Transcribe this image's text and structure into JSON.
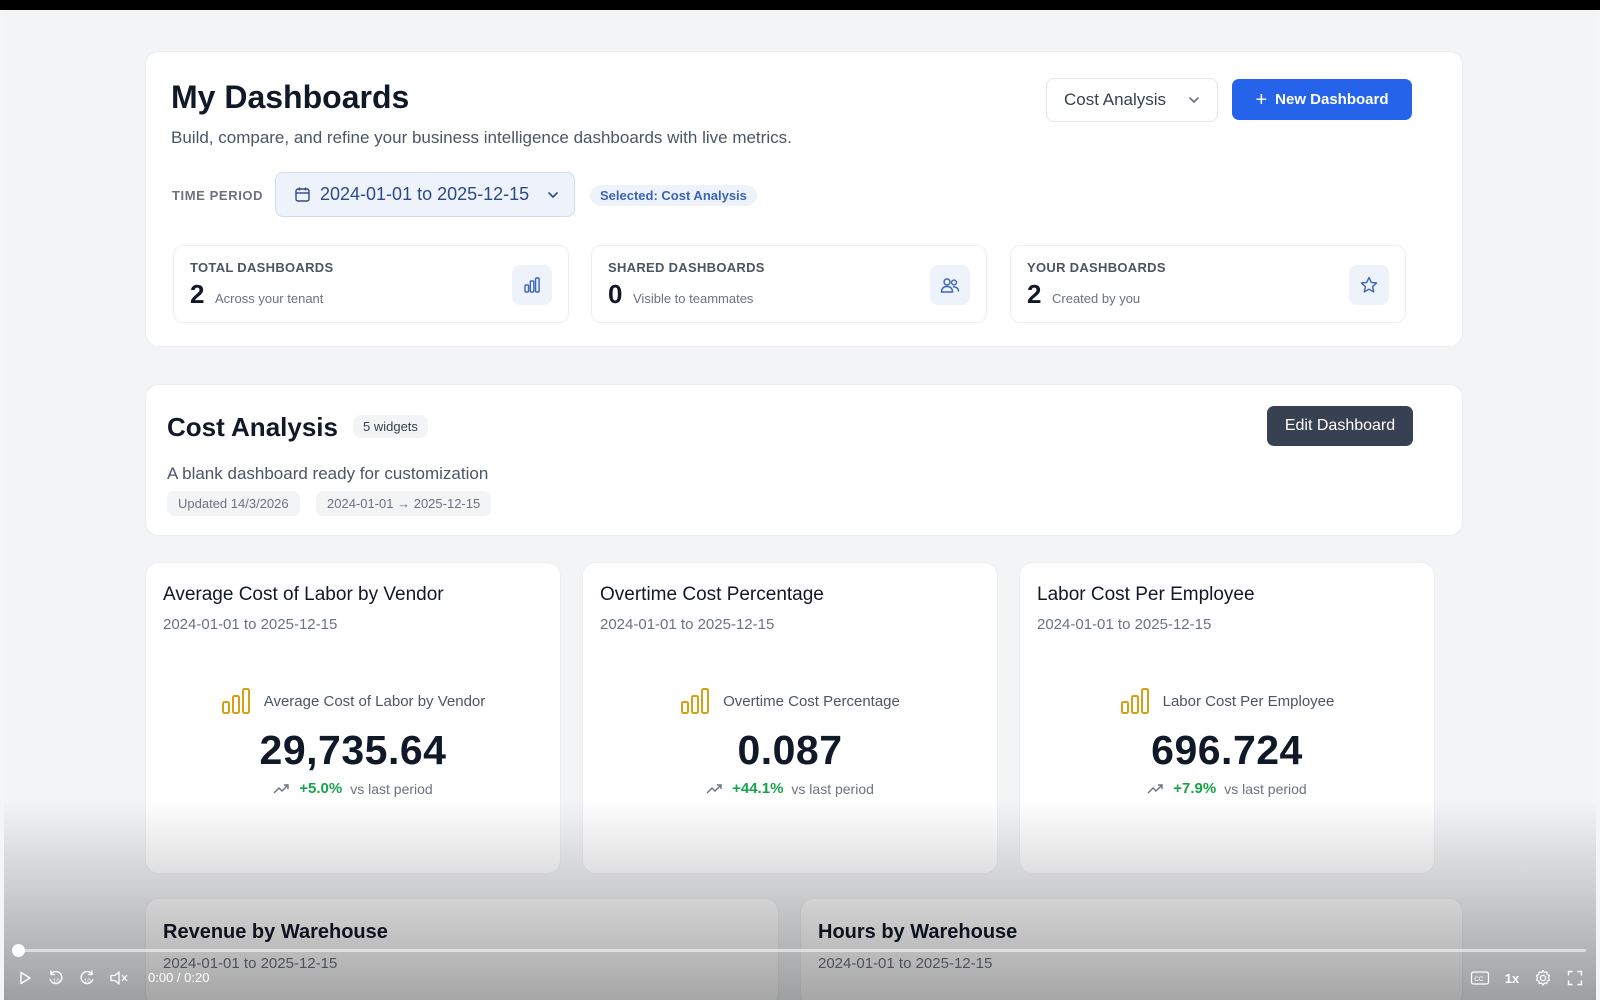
{
  "header": {
    "title": "My Dashboards",
    "subtitle": "Build, compare, and refine your business intelligence dashboards with live metrics.",
    "dashboard_select": {
      "value": "Cost Analysis"
    },
    "new_button": {
      "label": "New Dashboard"
    },
    "time_period": {
      "label": "TIME PERIOD",
      "value": "2024-01-01 to 2025-12-15",
      "selected_pill": "Selected: Cost Analysis"
    },
    "stats": [
      {
        "label": "TOTAL DASHBOARDS",
        "value": "2",
        "desc": "Across your tenant",
        "icon": "bar-chart-icon"
      },
      {
        "label": "SHARED DASHBOARDS",
        "value": "0",
        "desc": "Visible to teammates",
        "icon": "users-icon"
      },
      {
        "label": "YOUR DASHBOARDS",
        "value": "2",
        "desc": "Created by you",
        "icon": "star-icon"
      }
    ]
  },
  "dashboard": {
    "title": "Cost Analysis",
    "widget_count": "5 widgets",
    "description": "A blank dashboard ready for customization",
    "updated": "Updated 14/3/2026",
    "range": "2024-01-01 → 2025-12-15",
    "edit_button": "Edit Dashboard"
  },
  "widgets": [
    {
      "title": "Average Cost of Labor by Vendor",
      "date": "2024-01-01 to 2025-12-15",
      "metric": "Average Cost of Labor by Vendor",
      "value": "29,735.64",
      "change": "+5.0%",
      "vs": "vs last period"
    },
    {
      "title": "Overtime Cost Percentage",
      "date": "2024-01-01 to 2025-12-15",
      "metric": "Overtime Cost Percentage",
      "value": "0.087",
      "change": "+44.1%",
      "vs": "vs last period"
    },
    {
      "title": "Labor Cost Per Employee",
      "date": "2024-01-01 to 2025-12-15",
      "metric": "Labor Cost Per Employee",
      "value": "696.724",
      "change": "+7.9%",
      "vs": "vs last period"
    }
  ],
  "lower_widgets": [
    {
      "title": "Revenue by Warehouse",
      "date": "2024-01-01 to 2025-12-15"
    },
    {
      "title": "Hours by Warehouse",
      "date": "2024-01-01 to 2025-12-15"
    }
  ],
  "player": {
    "time": "0:00 / 0:20",
    "speed": "1x",
    "progress": 0.0
  },
  "colors": {
    "primary": "#2563eb",
    "dark_button": "#374151",
    "trend_up": "#16a34a",
    "metric_icon": "#d4a017",
    "accent_soft": "#eef3fb"
  }
}
